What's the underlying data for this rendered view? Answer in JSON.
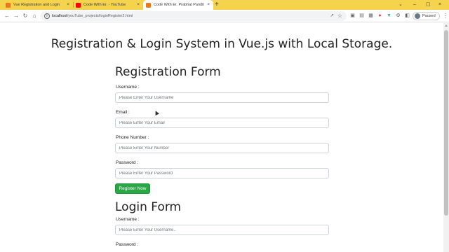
{
  "browser": {
    "tabs": [
      {
        "label": "Vue Registration and Login",
        "favicon_color": "#e8791e",
        "active": false
      },
      {
        "label": "Code With Er. - YouTube",
        "favicon_color": "#ff0000",
        "active": false
      },
      {
        "label": "Code With Er. Prabhat Pandit",
        "favicon_color": "#e8791e",
        "active": true
      }
    ],
    "tab_close_glyph": "×",
    "new_tab_glyph": "+",
    "address": {
      "host": "localhost",
      "path": "/youTube_projects/loginRegister2.html"
    },
    "profile_label": "Paused",
    "window_controls": {
      "minimize": "–",
      "restore": "▢",
      "close": "×",
      "chevron": "⌄"
    }
  },
  "page": {
    "heading": "Registration & Login System in Vue.js with Local Storage.",
    "registration": {
      "title": "Registration Form",
      "fields": [
        {
          "label": "Username :",
          "placeholder": "Please Enter Your Username"
        },
        {
          "label": "Email :",
          "placeholder": "Please Enter Your Email"
        },
        {
          "label": "Phone Number :",
          "placeholder": "Please Enter Your Number"
        },
        {
          "label": "Password :",
          "placeholder": "Please Enter Your Password"
        }
      ],
      "submit_label": "Register Now",
      "submit_color": "#28a745"
    },
    "login": {
      "title": "Login Form",
      "fields": [
        {
          "label": "Username :",
          "placeholder": "Please Enter Your Username.."
        },
        {
          "label": "Password :",
          "placeholder": ""
        }
      ]
    }
  },
  "colors": {
    "tabstrip": "#f5d34c",
    "accent_green": "#28a745"
  },
  "icons": [
    "back-arrow-icon",
    "forward-arrow-icon",
    "reload-icon",
    "home-icon",
    "info-icon",
    "share-icon",
    "star-icon",
    "extension-icons",
    "puzzle-icon",
    "sidebar-icon",
    "more-menu-icon"
  ]
}
